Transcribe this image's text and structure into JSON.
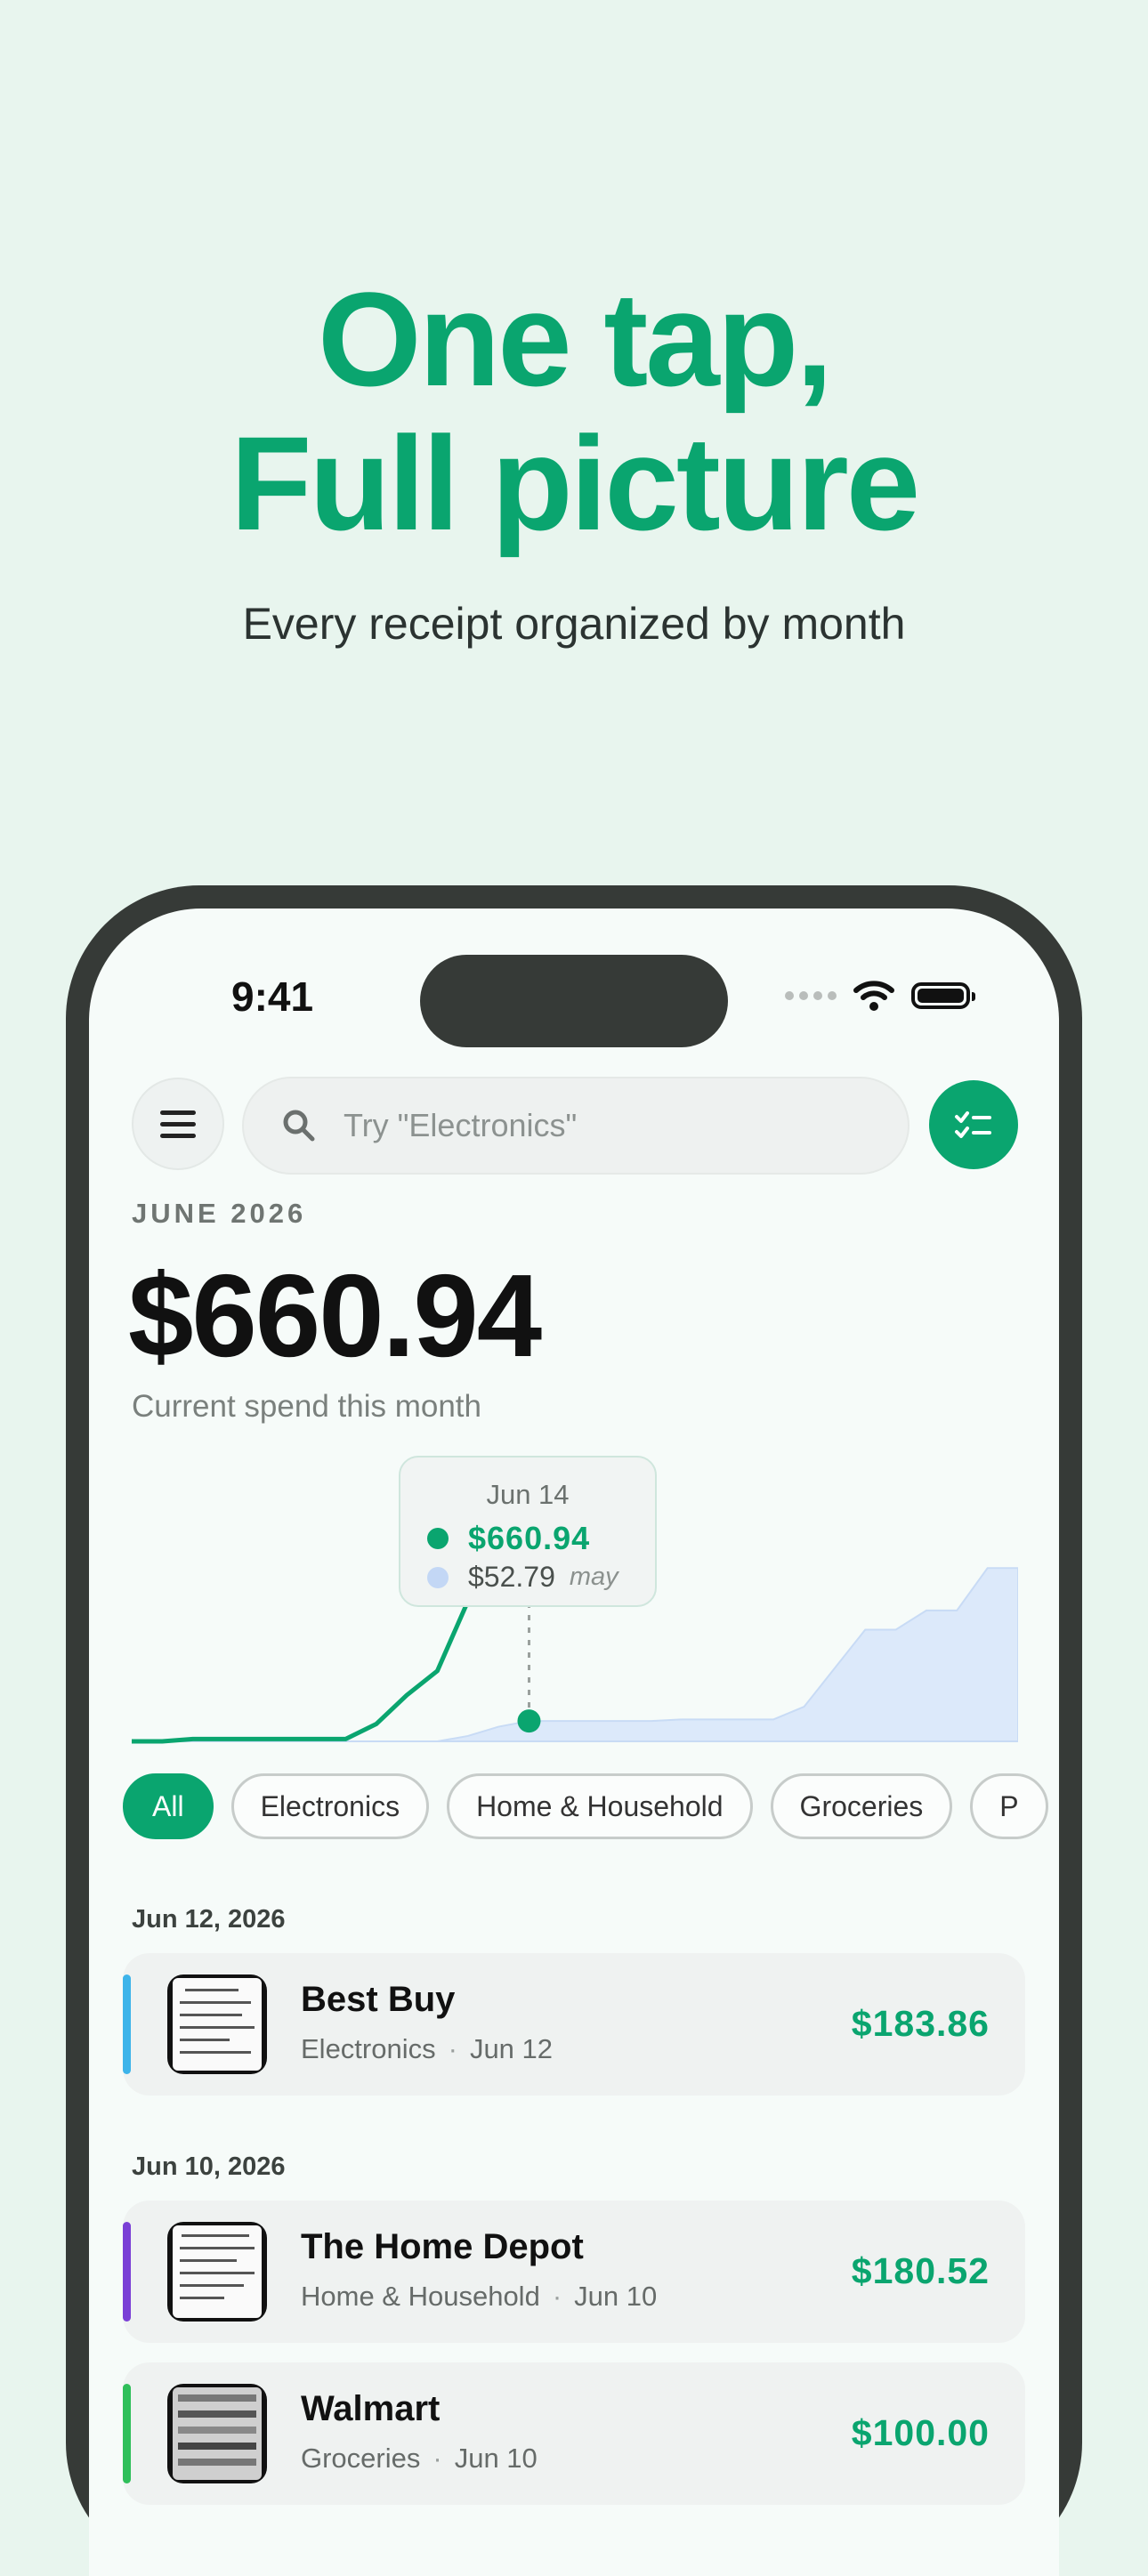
{
  "hero": {
    "title_line1": "One tap,",
    "title_line2": "Full picture",
    "subtitle": "Every receipt organized by month"
  },
  "status_bar": {
    "time": "9:41",
    "icons": [
      "signal-icon",
      "wifi-icon",
      "battery-icon"
    ]
  },
  "header": {
    "menu_icon": "hamburger-icon",
    "search": {
      "placeholder": "Try \"Electronics\"",
      "value": "",
      "icon": "search-icon"
    },
    "filter_icon": "checklist-icon"
  },
  "summary": {
    "month_label": "JUNE 2026",
    "amount": "$660.94",
    "caption": "Current spend this month"
  },
  "chart_data": {
    "type": "area",
    "current_series": {
      "color": "#0aa56f",
      "x": [
        1,
        2,
        3,
        4,
        5,
        6,
        7,
        8,
        9,
        10,
        11,
        12,
        13,
        14
      ],
      "values": [
        0,
        0,
        6,
        6,
        6,
        6,
        6,
        6,
        45,
        120,
        183,
        364,
        540,
        660.94
      ]
    },
    "previous_series": {
      "color": "#dce9fa",
      "x": [
        1,
        3,
        5,
        7,
        9,
        10,
        11,
        12,
        13,
        14,
        15,
        16,
        17,
        18,
        19,
        20,
        21,
        22,
        23,
        24,
        25,
        26,
        27,
        28,
        29,
        30
      ],
      "values": [
        0,
        0,
        0,
        0,
        0,
        0,
        0,
        14,
        38,
        52.79,
        52.79,
        52.79,
        52.79,
        52.79,
        57,
        57,
        57,
        57,
        90,
        190,
        290,
        290,
        340,
        340,
        450,
        450
      ]
    },
    "tooltip": {
      "date": "Jun 14",
      "current_value": "$660.94",
      "previous_value": "$52.79",
      "previous_label": "may"
    },
    "marker_x": 14,
    "marker_value": 52.79,
    "ylim": [
      0,
      660.94
    ],
    "xlim": [
      1,
      30
    ],
    "grid": false
  },
  "filters": [
    "All",
    "Electronics",
    "Home & Household",
    "Groceries",
    "P"
  ],
  "active_filter": "All",
  "groups": [
    {
      "date": "Jun 12, 2026",
      "receipts": [
        {
          "merchant": "Best Buy",
          "category": "Electronics",
          "date": "Jun 12",
          "amount": "$183.86",
          "color": "#3db4ea"
        }
      ]
    },
    {
      "date": "Jun 10, 2026",
      "receipts": [
        {
          "merchant": "The Home Depot",
          "category": "Home & Household",
          "date": "Jun 10",
          "amount": "$180.52",
          "color": "#7a3fd6"
        },
        {
          "merchant": "Walmart",
          "category": "Groceries",
          "date": "Jun 10",
          "amount": "$100.00",
          "color": "#2fbf5a"
        }
      ]
    }
  ],
  "meta_separator": "·"
}
